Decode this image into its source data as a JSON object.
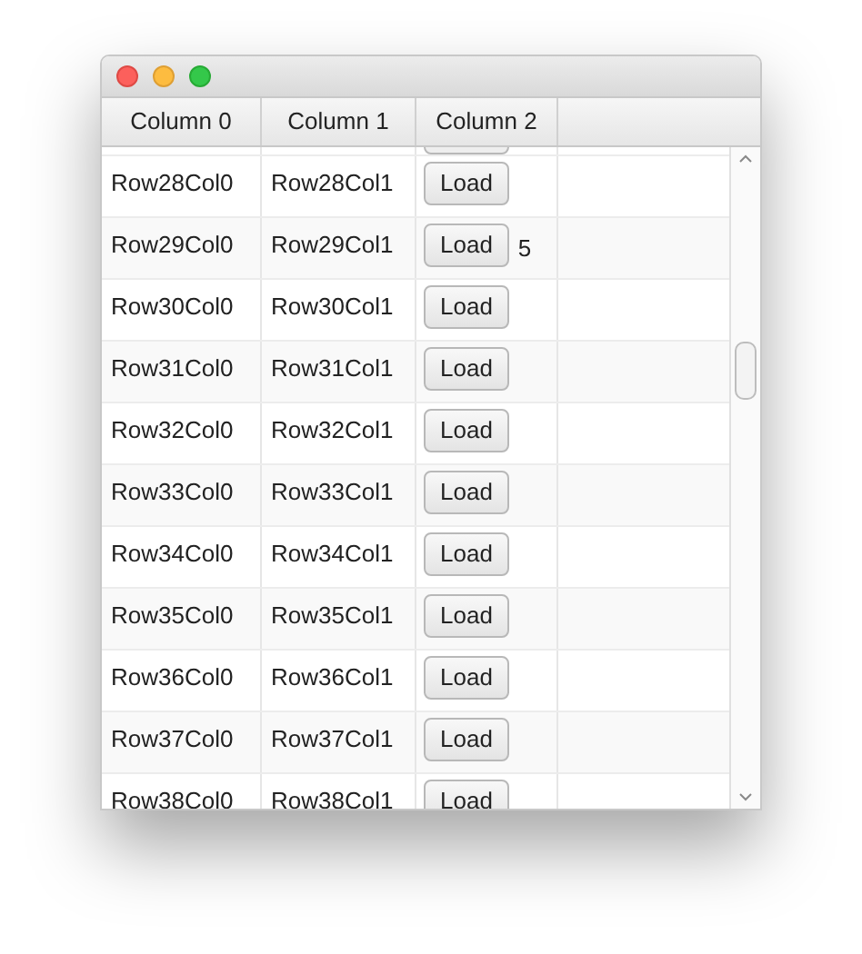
{
  "table": {
    "columns": [
      "Column 0",
      "Column 1",
      "Column 2"
    ],
    "rows": [
      {
        "cells": [
          "Row28Col0",
          "Row28Col1"
        ],
        "button": "Load"
      },
      {
        "cells": [
          "Row29Col0",
          "Row29Col1"
        ],
        "button": "Load",
        "note": "5"
      },
      {
        "cells": [
          "Row30Col0",
          "Row30Col1"
        ],
        "button": "Load"
      },
      {
        "cells": [
          "Row31Col0",
          "Row31Col1"
        ],
        "button": "Load"
      },
      {
        "cells": [
          "Row32Col0",
          "Row32Col1"
        ],
        "button": "Load"
      },
      {
        "cells": [
          "Row33Col0",
          "Row33Col1"
        ],
        "button": "Load"
      },
      {
        "cells": [
          "Row34Col0",
          "Row34Col1"
        ],
        "button": "Load"
      },
      {
        "cells": [
          "Row35Col0",
          "Row35Col1"
        ],
        "button": "Load"
      },
      {
        "cells": [
          "Row36Col0",
          "Row36Col1"
        ],
        "button": "Load"
      },
      {
        "cells": [
          "Row37Col0",
          "Row37Col1"
        ],
        "button": "Load"
      },
      {
        "cells": [
          "Row38Col0",
          "Row38Col1"
        ],
        "button": "Load"
      }
    ]
  }
}
